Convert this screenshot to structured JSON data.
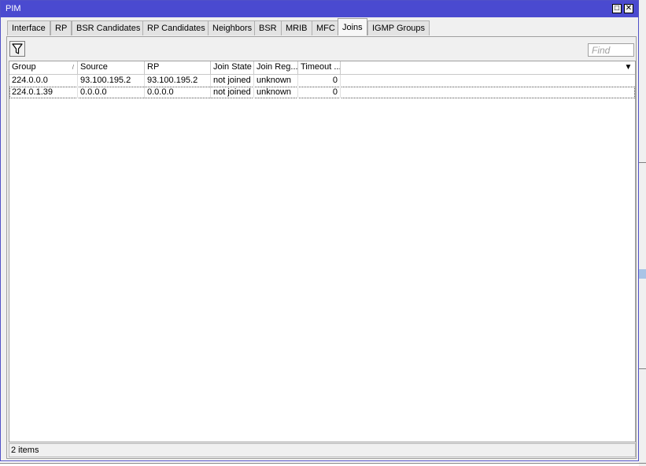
{
  "window": {
    "title": "PIM"
  },
  "tabs": [
    {
      "label": "Interface"
    },
    {
      "label": "RP"
    },
    {
      "label": "BSR Candidates"
    },
    {
      "label": "RP Candidates"
    },
    {
      "label": "Neighbors"
    },
    {
      "label": "BSR"
    },
    {
      "label": "MRIB"
    },
    {
      "label": "MFC"
    },
    {
      "label": "Joins",
      "active": true
    },
    {
      "label": "IGMP Groups"
    }
  ],
  "toolbar": {
    "find_placeholder": "Find",
    "filter_icon": "filter-icon"
  },
  "table": {
    "columns": [
      "Group",
      "Source",
      "RP",
      "Join State",
      "Join Reg...",
      "Timeout ..."
    ],
    "rows": [
      [
        "224.0.0.0",
        "93.100.195.2",
        "93.100.195.2",
        "not joined",
        "unknown",
        "0"
      ],
      [
        "224.0.1.39",
        "0.0.0.0",
        "0.0.0.0",
        "not joined",
        "unknown",
        "0"
      ]
    ]
  },
  "status": {
    "text": "2 items"
  },
  "colors": {
    "titlebar": "#4a4ad0",
    "window_bg": "#f0f0f0"
  }
}
